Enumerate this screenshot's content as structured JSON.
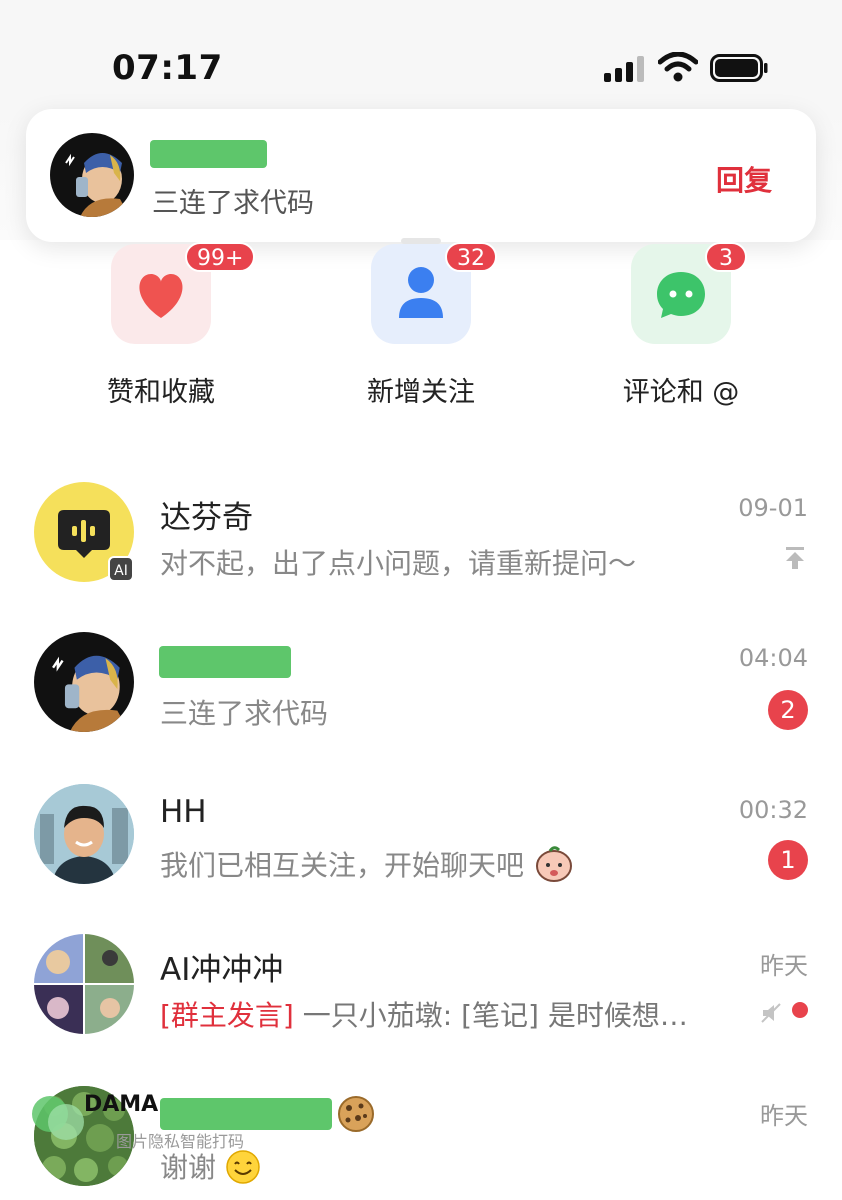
{
  "status_bar": {
    "time": "07:17"
  },
  "notification": {
    "message": "三连了求代码",
    "reply_label": "回复"
  },
  "categories": [
    {
      "label": "赞和收藏",
      "badge": "99+",
      "icon": "heart-icon",
      "color": "#ef5350"
    },
    {
      "label": "新增关注",
      "badge": "32",
      "icon": "person-icon",
      "color": "#3b7ff0"
    },
    {
      "label": "评论和 @",
      "badge": "3",
      "icon": "chat-bubble-icon",
      "color": "#3dc46a"
    }
  ],
  "chats": [
    {
      "title": "达芬奇",
      "preview": "对不起，出了点小问题，请重新提问～",
      "time": "09-01",
      "ai_tag": "AI"
    },
    {
      "preview": "三连了求代码",
      "time": "04:04",
      "unread": "2"
    },
    {
      "title": "HH",
      "preview": "我们已相互关注，开始聊天吧",
      "time": "00:32",
      "unread": "1"
    },
    {
      "title": "AI冲冲冲",
      "preview_tag": "[群主发言]",
      "preview": " 一只小茄墩: [笔记] 是时候想…",
      "time": "昨天"
    },
    {
      "preview": "谢谢",
      "time": "昨天"
    }
  ],
  "watermark": {
    "brand": "DAMA",
    "caption": "图片隐私智能打码"
  },
  "colors": {
    "accent_red": "#e0303c",
    "badge_red": "#e8434c",
    "mask_green": "#5ec66b"
  }
}
